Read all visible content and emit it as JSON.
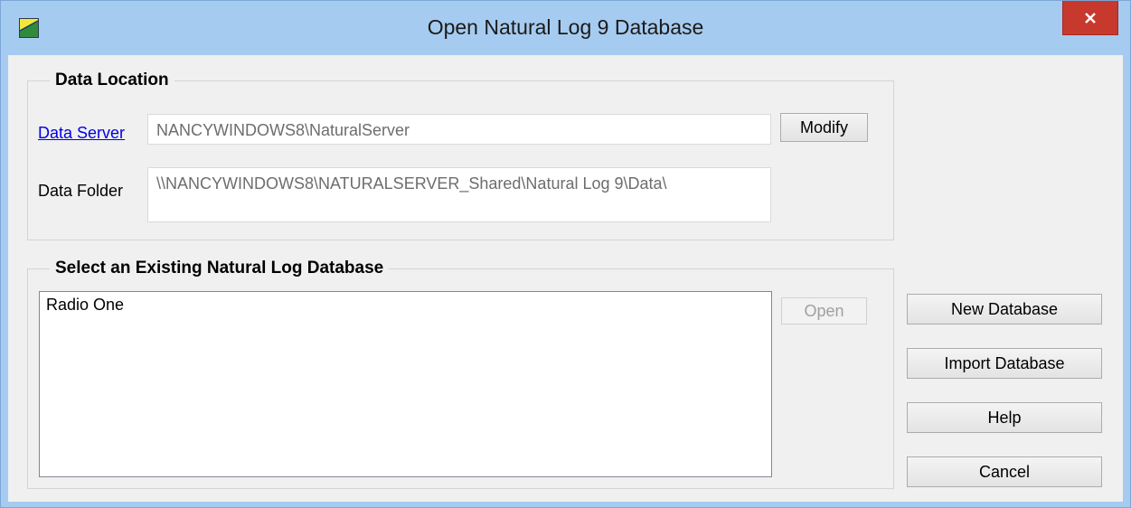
{
  "window": {
    "title": "Open Natural Log 9 Database",
    "close_glyph": "✕"
  },
  "data_location": {
    "group_title": "Data Location",
    "server_label": "Data Server",
    "server_value": "NANCYWINDOWS8\\NaturalServer",
    "modify_label": "Modify",
    "folder_label": "Data Folder",
    "folder_value": "\\\\NANCYWINDOWS8\\NATURALSERVER_Shared\\Natural Log 9\\Data\\"
  },
  "existing": {
    "group_title": "Select an Existing Natural Log Database",
    "items": [
      "Radio One"
    ],
    "open_label": "Open"
  },
  "actions": {
    "new_label": "New Database",
    "import_label": "Import Database",
    "help_label": "Help",
    "cancel_label": "Cancel"
  },
  "icons": {
    "app": "natural-log-app-icon",
    "close": "close-icon"
  },
  "colors": {
    "titlebar": "#a6cbf0",
    "close_button": "#c7392d",
    "client_background": "#f0f0f0",
    "link": "#0000e6"
  }
}
